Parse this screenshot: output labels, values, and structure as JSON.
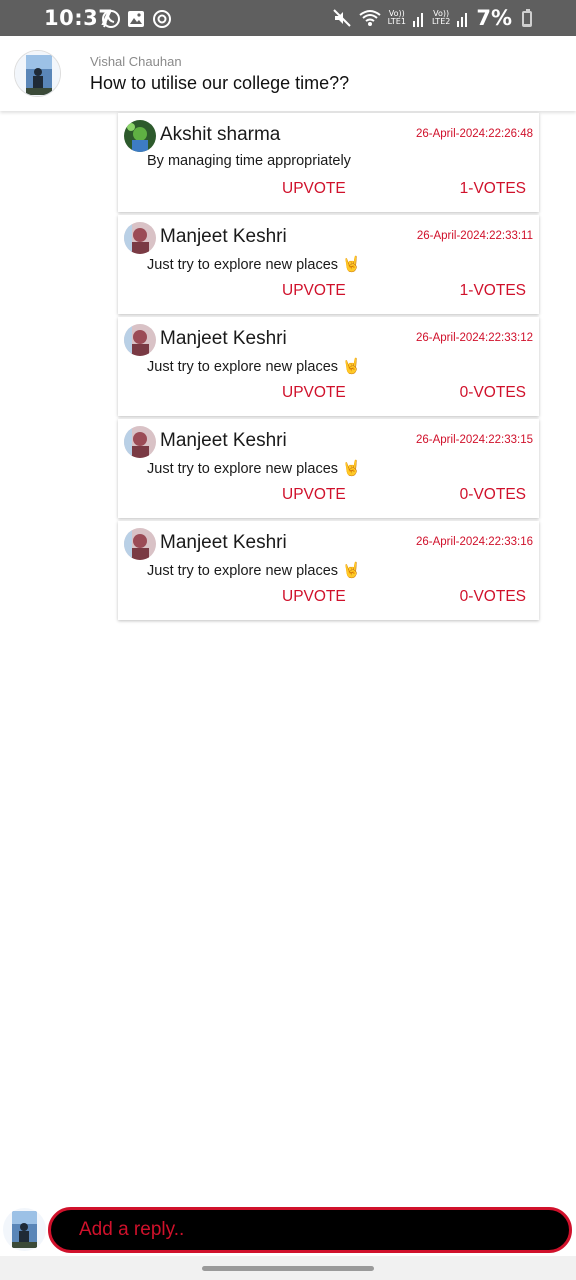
{
  "status_bar": {
    "time": "10:37",
    "battery_percent": "7%",
    "battery_level": 0.07,
    "net1_top": "Vo))",
    "net1_bottom": "LTE1",
    "net2_top": "Vo))",
    "net2_bottom": "LTE2",
    "icons": [
      "whatsapp-icon",
      "gallery-icon",
      "sync-icon",
      "mute-icon",
      "wifi-icon",
      "signal-icon",
      "battery-icon"
    ]
  },
  "question": {
    "author": "Vishal Chauhan",
    "title": "How to utilise our college time??"
  },
  "replies": [
    {
      "name": "Akshit sharma",
      "timestamp": "26-April-2024:22:26:48",
      "text": "By managing time appropriately",
      "emoji": "",
      "upvote_label": "UPVOTE",
      "votes": "1-VOTES"
    },
    {
      "name": "Manjeet Keshri",
      "timestamp": "26-April-2024:22:33:11",
      "text": "Just try to explore new places",
      "emoji": "🤘",
      "upvote_label": "UPVOTE",
      "votes": "1-VOTES"
    },
    {
      "name": "Manjeet Keshri",
      "timestamp": "26-April-2024:22:33:12",
      "text": "Just try to explore new places",
      "emoji": "🤘",
      "upvote_label": "UPVOTE",
      "votes": "0-VOTES"
    },
    {
      "name": "Manjeet Keshri",
      "timestamp": "26-April-2024:22:33:15",
      "text": "Just try to explore new places",
      "emoji": "🤘",
      "upvote_label": "UPVOTE",
      "votes": "0-VOTES"
    },
    {
      "name": "Manjeet Keshri",
      "timestamp": "26-April-2024:22:33:16",
      "text": "Just try to explore new places",
      "emoji": "🤘",
      "upvote_label": "UPVOTE",
      "votes": "0-VOTES"
    }
  ],
  "reply_bar": {
    "placeholder": "Add a reply.."
  },
  "colors": {
    "accent": "#d0112b",
    "status_bar": "#5f5f5f",
    "input_bg": "#000000"
  }
}
